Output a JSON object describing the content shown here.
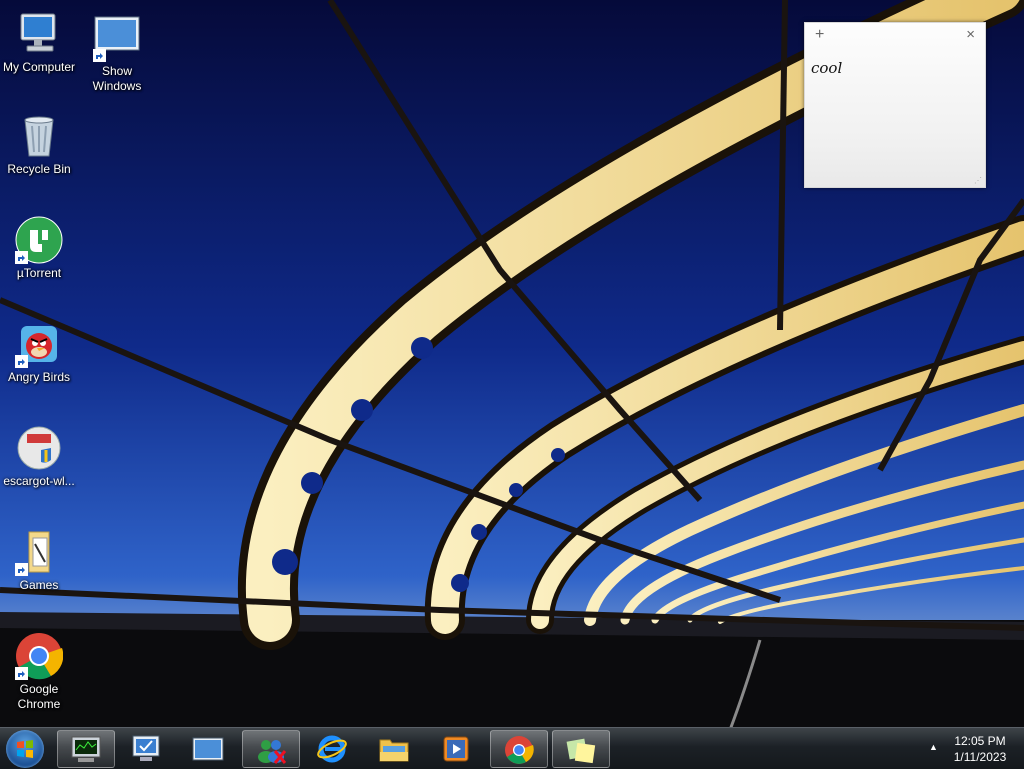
{
  "desktop": {
    "icons": [
      {
        "label": "My Computer"
      },
      {
        "label": "Show\nWindows"
      },
      {
        "label": "Recycle Bin"
      },
      {
        "label": "µTorrent"
      },
      {
        "label": "Angry Birds"
      },
      {
        "label": "escargot-wl..."
      },
      {
        "label": "Games"
      },
      {
        "label": "Google\nChrome"
      }
    ]
  },
  "sticky_note": {
    "add_symbol": "+",
    "close_symbol": "×",
    "text": "cool"
  },
  "taskbar": {
    "items": [
      {
        "icon": "start-orb-icon"
      },
      {
        "icon": "task-manager-icon",
        "active": true
      },
      {
        "icon": "remote-desktop-icon"
      },
      {
        "icon": "show-desktop-icon"
      },
      {
        "icon": "messenger-icon",
        "active": true
      },
      {
        "icon": "internet-explorer-icon"
      },
      {
        "icon": "file-explorer-icon"
      },
      {
        "icon": "media-player-icon"
      },
      {
        "icon": "chrome-icon",
        "active": true
      },
      {
        "icon": "sticky-notes-icon",
        "active": true
      }
    ],
    "tray_arrow": "▲",
    "clock": {
      "time": "12:05 PM",
      "date": "1/11/2023"
    }
  }
}
